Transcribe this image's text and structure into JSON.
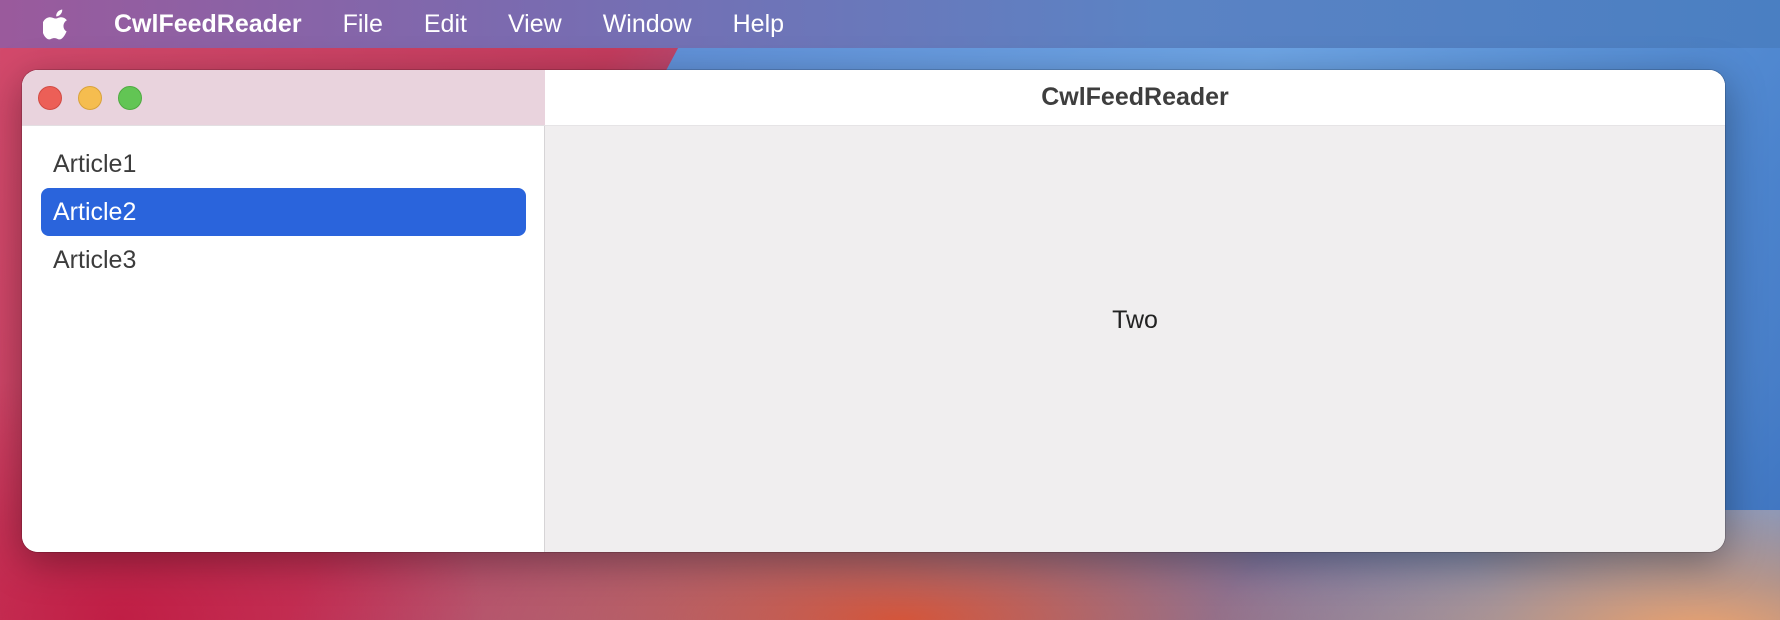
{
  "menubar": {
    "apple_icon": "apple-logo-icon",
    "app_name": "CwlFeedReader",
    "items": [
      {
        "label": "File"
      },
      {
        "label": "Edit"
      },
      {
        "label": "View"
      },
      {
        "label": "Window"
      },
      {
        "label": "Help"
      }
    ]
  },
  "window": {
    "title": "CwlFeedReader",
    "traffic_lights": {
      "close_color": "#ec5f57",
      "minimize_color": "#f5bd4f",
      "zoom_color": "#62c554"
    }
  },
  "sidebar": {
    "selection_color": "#2a64dc",
    "articles": [
      {
        "label": "Article1",
        "selected": false
      },
      {
        "label": "Article2",
        "selected": true
      },
      {
        "label": "Article3",
        "selected": false
      }
    ]
  },
  "detail": {
    "text": "Two"
  }
}
